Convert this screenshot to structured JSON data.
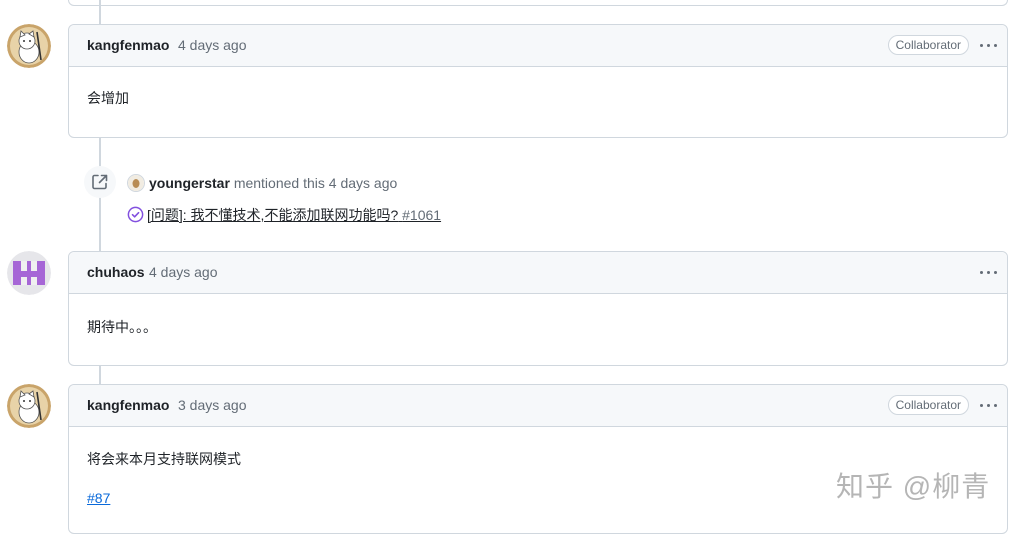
{
  "comments": [
    {
      "author": "kangfenmao",
      "time": "4 days ago",
      "badge": "Collaborator",
      "body": "会增加"
    },
    {
      "author": "chuhaos",
      "time": "4 days ago",
      "badge": "",
      "body": "期待中。。。"
    },
    {
      "author": "kangfenmao",
      "time": "3 days ago",
      "badge": "Collaborator",
      "body": "将会来本月支持联网模式",
      "reference": "#87"
    }
  ],
  "mention_event": {
    "actor": "youngerstar",
    "action": "mentioned this",
    "time": "4 days ago",
    "issue_title": "[问题]: 我不懂技术,不能添加联网功能吗?",
    "issue_number": "#1061"
  },
  "watermark": "知乎 @柳青",
  "icons": {
    "more": "kebab-horizontal-icon",
    "cross_reference": "link-external-icon",
    "issue_state": "check-circle-icon"
  },
  "colors": {
    "border": "#d0d7de",
    "header_bg": "#f6f8fa",
    "muted": "#636c76",
    "link": "#0969da",
    "issue_closed": "#8250df",
    "avatar_kangfenmao": "#c9a46a",
    "avatar_chuhaos": "#a666d6"
  }
}
